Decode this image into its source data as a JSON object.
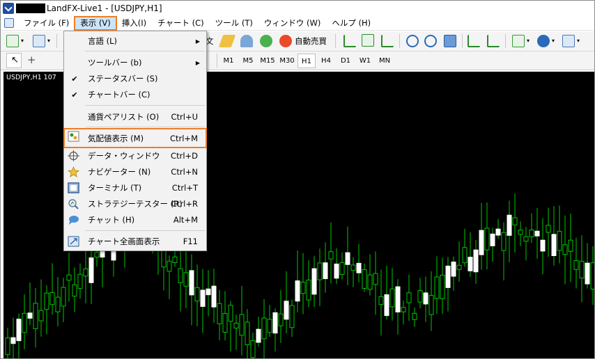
{
  "window": {
    "title": "LandFX-Live1 - [USDJPY,H1]"
  },
  "menubar": {
    "items": [
      {
        "label": "ファイル (F)"
      },
      {
        "label": "表示 (V)"
      },
      {
        "label": "挿入(I)"
      },
      {
        "label": "チャート (C)"
      },
      {
        "label": "ツール (T)"
      },
      {
        "label": "ウィンドウ (W)"
      },
      {
        "label": "ヘルプ (H)"
      }
    ]
  },
  "toolbar": {
    "new_order_label": "文",
    "autotrade_label": "自動売買",
    "timeframes": [
      "M1",
      "M5",
      "M15",
      "M30",
      "H1",
      "H4",
      "D1",
      "W1",
      "MN"
    ],
    "selected_timeframe": "H1"
  },
  "chart": {
    "label": "USDJPY,H1  107",
    "bull_color": "#ffffff",
    "bear_color": "#00c800",
    "background": "#000000"
  },
  "view_menu": {
    "items": [
      {
        "label": "言語 (L)",
        "shortcut": "",
        "submenu": true
      },
      {
        "label": "ツールバー (b)",
        "shortcut": "",
        "submenu": true
      },
      {
        "label": "ステータスバー (S)",
        "shortcut": "",
        "checked": true
      },
      {
        "label": "チャートバー (C)",
        "shortcut": "",
        "checked": true
      },
      {
        "label": "通貨ペアリスト (O)",
        "shortcut": "Ctrl+U"
      },
      {
        "label": "気配値表示 (M)",
        "shortcut": "Ctrl+M",
        "highlighted": true,
        "icon": "market-watch-icon"
      },
      {
        "label": "データ・ウィンドウ",
        "shortcut": "Ctrl+D",
        "icon": "crosshair-icon"
      },
      {
        "label": "ナビゲーター (N)",
        "shortcut": "Ctrl+N",
        "icon": "navigator-star-icon"
      },
      {
        "label": "ターミナル (T)",
        "shortcut": "Ctrl+T",
        "icon": "terminal-icon"
      },
      {
        "label": "ストラテジーテスター (R)",
        "shortcut": "Ctrl+R",
        "icon": "tester-icon"
      },
      {
        "label": "チャット (H)",
        "shortcut": "Alt+M",
        "icon": "chat-icon"
      },
      {
        "label": "チャート全画面表示",
        "shortcut": "F11",
        "icon": "fullscreen-icon"
      }
    ],
    "check_mark": "✔",
    "submenu_arrow": "▶"
  }
}
